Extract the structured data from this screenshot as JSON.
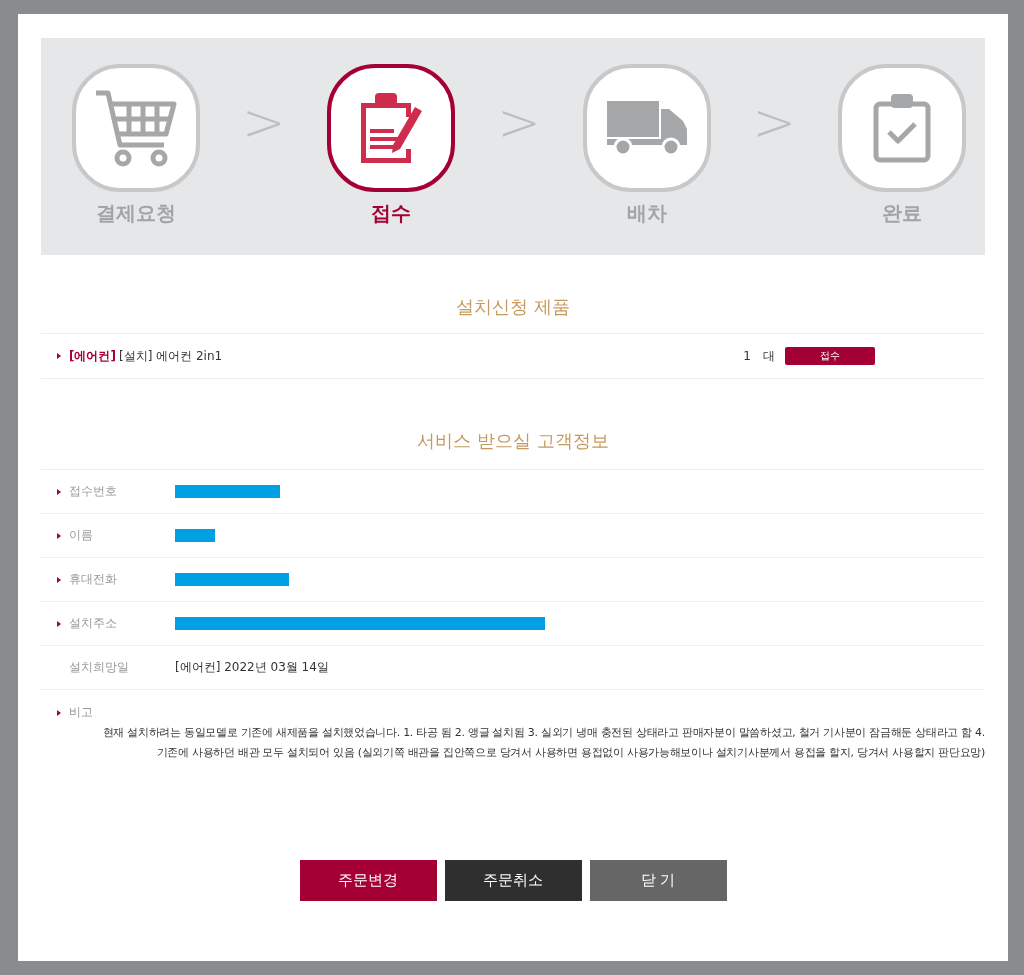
{
  "steps": [
    {
      "label": "결제요청",
      "kind": "cart",
      "selected": false
    },
    {
      "label": "접수",
      "kind": "clipboard-pen",
      "selected": true
    },
    {
      "label": "배차",
      "kind": "truck",
      "selected": false
    },
    {
      "label": "완료",
      "kind": "clipboard-check",
      "selected": false
    }
  ],
  "separator": ">",
  "product_section": {
    "title": "설치신청 제품",
    "items": [
      {
        "category": "[에어컨]",
        "name": "[설치] 에어컨 2in1",
        "quantity": "1",
        "unit": "대",
        "status": "접수"
      }
    ]
  },
  "customer_section": {
    "title": "서비스 받으실 고객정보",
    "fields": [
      {
        "label": "접수번호",
        "kind": "redacted",
        "required": true
      },
      {
        "label": "이름",
        "kind": "redacted",
        "required": true
      },
      {
        "label": "휴대전화",
        "kind": "redacted",
        "required": true
      },
      {
        "label": "설치주소",
        "kind": "redacted",
        "required": true
      },
      {
        "label": "설치희망일",
        "kind": "text",
        "required": false,
        "value": "[에어컨] 2022년 03월 14일"
      },
      {
        "label": "비고",
        "kind": "note",
        "required": true,
        "value": "현재 설치하려는 동일모델로 기존에 새제품을 설치했었습니다. 1. 타공 됨 2. 앵글 설치됨 3. 실외기 냉매 충전된 상태라고 판매자분이 말씀하셨고, 철거 기사분이 잠금해둔 상태라고 함 4. 기존에 사용하던 배관 모두 설치되어 있음 (실외기쪽 배관을 집안쪽으로 당겨서 사용하면 용접없이 사용가능해보이나 설치기사분께서 용접을 할지, 당겨서 사용할지 판단요망)"
      }
    ]
  },
  "buttons": [
    {
      "label": "주문변경",
      "kind": "primary"
    },
    {
      "label": "주문취소",
      "kind": "dark"
    },
    {
      "label": "닫 기",
      "kind": "gray"
    }
  ]
}
